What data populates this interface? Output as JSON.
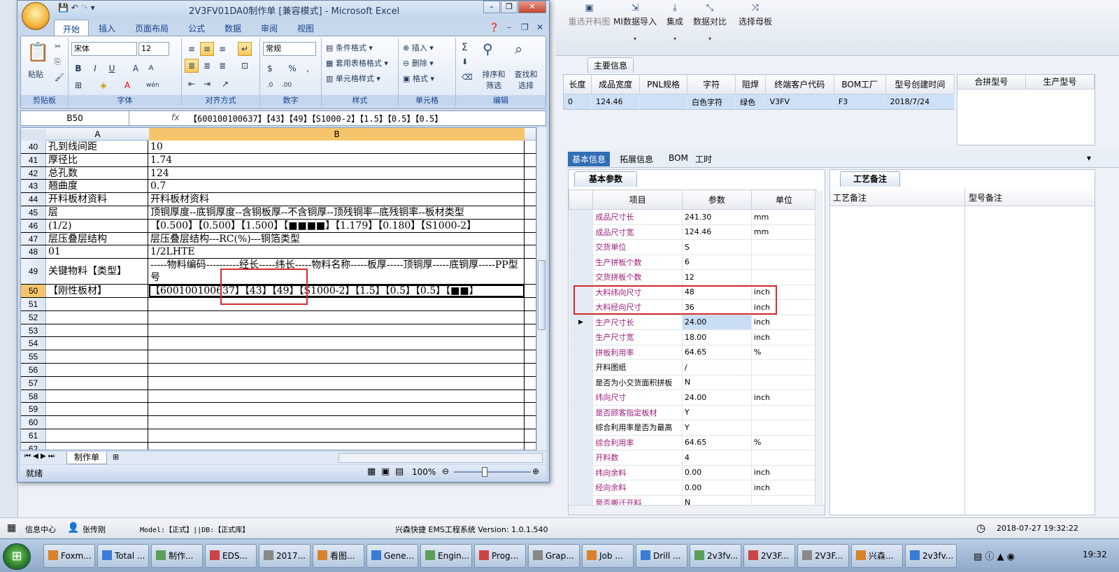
{
  "excel": {
    "title": "2V3FV01DA0制作单 [兼容模式] - Microsoft Excel",
    "tabs": [
      "开始",
      "插入",
      "页面布局",
      "公式",
      "数据",
      "审阅",
      "视图"
    ],
    "ribbon": {
      "paste_label": "粘贴",
      "font_name": "宋体",
      "font_size": "12",
      "number_format": "常规",
      "styles": [
        "条件格式",
        "套用表格格式",
        "单元格样式"
      ],
      "cells": [
        "插入",
        "删除",
        "格式"
      ],
      "edit": [
        "排序和筛选",
        "查找和选择"
      ],
      "groups": [
        "剪贴板",
        "字体",
        "对齐方式",
        "数字",
        "样式",
        "单元格",
        "编辑"
      ]
    },
    "name_box": "B50",
    "fx": "fx",
    "formula": "【600100100637】【43】【49】【S1000-2】【1.5】【0.5】【0.5】",
    "col_headers": [
      "A",
      "B"
    ],
    "rows": [
      {
        "n": "40",
        "a": "孔到线间距",
        "b": "10"
      },
      {
        "n": "41",
        "a": "厚径比",
        "b": "1.74"
      },
      {
        "n": "42",
        "a": "总孔数",
        "b": "124"
      },
      {
        "n": "43",
        "a": "翘曲度",
        "b": "0.7"
      },
      {
        "n": "44",
        "a": "开料板材资料",
        "b": "开料板材资料"
      },
      {
        "n": "45",
        "a": "层",
        "b": "顶铜厚度--底铜厚度--含铜板厚--不含铜厚--顶残铜率--底残铜率--板材类型"
      },
      {
        "n": "46",
        "a": "(1/2)",
        "b": "【0.500】【0.500】【1.500】【■■■■】【1.179】【0.180】【S1000-2】"
      },
      {
        "n": "47",
        "a": "层压叠层结构",
        "b": "层压叠层结构---RC(%)---铜箔类型"
      },
      {
        "n": "48",
        "a": "01",
        "b": "1/2LHTE"
      },
      {
        "n": "49",
        "a": "关键物料【类型】",
        "b": "-----物料编码----------经长-----纬长-----物料名称-----板厚-----顶铜厚-----底铜厚-----PP型号"
      },
      {
        "n": "50",
        "a": "【刚性板材】",
        "b": "【600100100637】【43】【49】【S1000-2】【1.5】【0.5】【0.5】【■■】"
      },
      {
        "n": "51",
        "a": "",
        "b": ""
      },
      {
        "n": "52",
        "a": "",
        "b": ""
      },
      {
        "n": "53",
        "a": "",
        "b": ""
      },
      {
        "n": "54",
        "a": "",
        "b": ""
      },
      {
        "n": "55",
        "a": "",
        "b": ""
      },
      {
        "n": "56",
        "a": "",
        "b": ""
      },
      {
        "n": "57",
        "a": "",
        "b": ""
      },
      {
        "n": "58",
        "a": "",
        "b": ""
      },
      {
        "n": "59",
        "a": "",
        "b": ""
      },
      {
        "n": "60",
        "a": "",
        "b": ""
      },
      {
        "n": "61",
        "a": "",
        "b": ""
      },
      {
        "n": "62",
        "a": "",
        "b": ""
      }
    ],
    "sheet_tab": "制作单",
    "status": "就绪",
    "zoom": "100%"
  },
  "app": {
    "toolbar": [
      "重选开料图",
      "MI数据导入",
      "集成",
      "数据对比",
      "选择母板"
    ],
    "main_info_tab": "主要信息",
    "top_headers": [
      "长度",
      "成品宽度",
      "PNL规格",
      "字符",
      "阻焊",
      "终端客户代码",
      "BOM工厂",
      "型号创建时间"
    ],
    "top_row": [
      "0",
      "124.46",
      "",
      "白色字符",
      "绿色",
      "V3FV",
      "F3",
      "2018/7/24"
    ],
    "right_headers": [
      "合拼型号",
      "生产型号"
    ],
    "sub_tabs": [
      "基本信息",
      "拓展信息",
      "BOM",
      "工时"
    ],
    "params_title": "基本参数",
    "params_headers": [
      "项目",
      "参数",
      "单位"
    ],
    "params": [
      {
        "name": "成品尺寸长",
        "value": "241.30",
        "unit": "mm"
      },
      {
        "name": "成品尺寸宽",
        "value": "124.46",
        "unit": "mm"
      },
      {
        "name": "交货单位",
        "value": "S",
        "unit": ""
      },
      {
        "name": "生产拼板个数",
        "value": "6",
        "unit": ""
      },
      {
        "name": "交货拼板个数",
        "value": "12",
        "unit": ""
      },
      {
        "name": "大料纬向尺寸",
        "value": "48",
        "unit": "inch"
      },
      {
        "name": "大料经向尺寸",
        "value": "36",
        "unit": "inch"
      },
      {
        "name": "生产尺寸长",
        "value": "24.00",
        "unit": "inch"
      },
      {
        "name": "生产尺寸宽",
        "value": "18.00",
        "unit": "inch"
      },
      {
        "name": "拼板利用率",
        "value": "64.65",
        "unit": "%"
      },
      {
        "name": "开料图纸",
        "value": "/",
        "unit": ""
      },
      {
        "name": "是否为小交货面积拼板",
        "value": "N",
        "unit": ""
      },
      {
        "name": "纬向尺寸",
        "value": "24.00",
        "unit": "inch"
      },
      {
        "name": "是否顾客指定板材",
        "value": "Y",
        "unit": ""
      },
      {
        "name": "综合利用率是否为最高",
        "value": "Y",
        "unit": ""
      },
      {
        "name": "综合利用率",
        "value": "64.65",
        "unit": "%"
      },
      {
        "name": "开料数",
        "value": "4",
        "unit": ""
      },
      {
        "name": "纬向余料",
        "value": "0.00",
        "unit": "inch"
      },
      {
        "name": "经向余料",
        "value": "0.00",
        "unit": "inch"
      },
      {
        "name": "是否搬迁开料",
        "value": "N",
        "unit": ""
      }
    ],
    "craft_title": "工艺备注",
    "craft_headers": [
      "工艺备注",
      "型号备注"
    ],
    "status": {
      "info_center": "信息中心",
      "user": "张传刚",
      "model": "Model:【正式】||DB:【正式库】",
      "system": "兴森快捷 EMS工程系统 Version: 1.0.1.540",
      "datetime": "2018-07-27 19:32:22"
    }
  },
  "taskbar": {
    "tasks": [
      "Foxm...",
      "Total ...",
      "制作...",
      "EDS...",
      "2017...",
      "看图...",
      "Gene...",
      "Engin...",
      "Prog...",
      "Grap...",
      "Job ...",
      "Drill ...",
      "2v3fv...",
      "2V3F...",
      "2V3F...",
      "兴森...",
      "2v3fv..."
    ],
    "time": "19:32"
  }
}
